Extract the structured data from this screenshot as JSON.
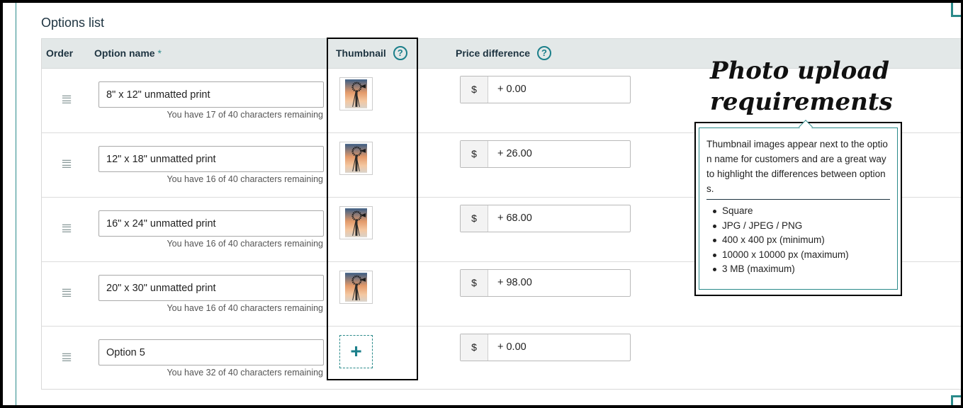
{
  "section_title": "Options list",
  "headers": {
    "order": "Order",
    "option_name": "Option name",
    "required_mark": "*",
    "thumbnail": "Thumbnail",
    "price_difference": "Price difference",
    "help_glyph": "?"
  },
  "rows": [
    {
      "name": "8\" x 12\" unmatted print",
      "remaining": "You have 17 of 40 characters remaining",
      "currency": "$",
      "price": "+ 0.00",
      "has_thumbnail": true
    },
    {
      "name": "12\" x 18\" unmatted print",
      "remaining": "You have 16 of 40 characters remaining",
      "currency": "$",
      "price": "+ 26.00",
      "has_thumbnail": true
    },
    {
      "name": "16\" x 24\" unmatted print",
      "remaining": "You have 16 of 40 characters remaining",
      "currency": "$",
      "price": "+ 68.00",
      "has_thumbnail": true
    },
    {
      "name": "20\" x 30\" unmatted print",
      "remaining": "You have 16 of 40 characters remaining",
      "currency": "$",
      "price": "+ 98.00",
      "has_thumbnail": true
    },
    {
      "name": "Option 5",
      "remaining": "You have 32 of 40 characters remaining",
      "currency": "$",
      "price": "+ 0.00",
      "has_thumbnail": false
    }
  ],
  "add_thumbnail_glyph": "+",
  "annotation": {
    "line1": "Photo upload",
    "line2": "requirements"
  },
  "tooltip": {
    "text": "Thumbnail images appear next to the option name for customers and are a great way to highlight the differences between options.",
    "requirements": [
      "Square",
      "JPG / JPEG / PNG",
      "400 x 400 px (minimum)",
      "10000 x 10000 px (maximum)",
      "3 MB (maximum)"
    ]
  },
  "colors": {
    "accent": "#1b7f8a",
    "header_bg": "#e3e8e8"
  }
}
